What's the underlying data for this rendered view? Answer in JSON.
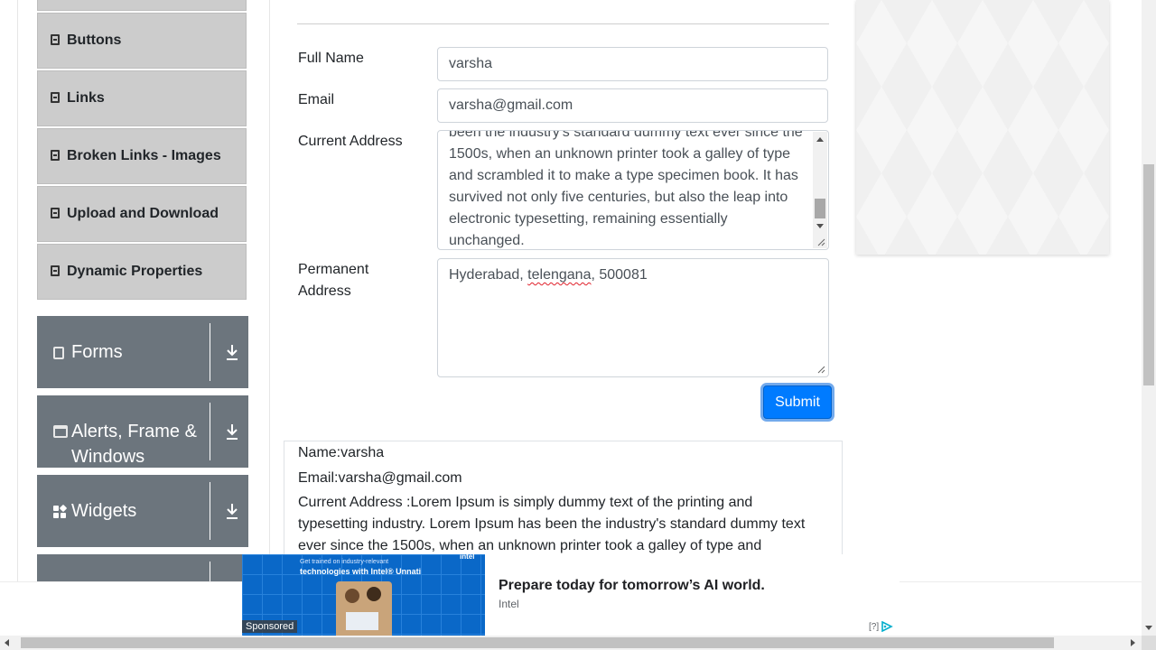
{
  "sidebar": {
    "element_items": [
      {
        "label": "Buttons"
      },
      {
        "label": "Links"
      },
      {
        "label": "Broken Links - Images"
      },
      {
        "label": "Upload and Download"
      },
      {
        "label": "Dynamic Properties"
      }
    ],
    "groups": [
      {
        "label": "Forms",
        "icon": "form-icon"
      },
      {
        "label": "Alerts, Frame & Windows",
        "icon": "window-icon"
      },
      {
        "label": "Widgets",
        "icon": "widgets-icon"
      }
    ]
  },
  "form": {
    "full_name": {
      "label": "Full Name",
      "value": "varsha"
    },
    "email": {
      "label": "Email",
      "value": "varsha@gmail.com"
    },
    "current_address": {
      "label": "Current Address",
      "visible_lines": [
        "been the industry's standard dummy text ever since the",
        "1500s, when an unknown printer took a galley of type",
        "and scrambled it to make a type specimen book. It has",
        "survived not only five centuries, but also the leap into",
        "electronic typesetting, remaining essentially",
        "unchanged."
      ]
    },
    "permanent_address": {
      "label_line1": "Permanent",
      "label_line2": "Address",
      "value_part1": "Hyderabad, ",
      "value_misspelled": "telengana",
      "value_part2": ", 500081"
    },
    "submit_label": "Submit"
  },
  "output": {
    "name": "Name:varsha",
    "email": "Email:varsha@gmail.com",
    "current_address": "Current Address :Lorem Ipsum is simply dummy text of the printing and typesetting industry. Lorem Ipsum has been the industry's standard dummy text ever since the 1500s, when an unknown printer took a galley of type and"
  },
  "ad": {
    "image_small_text": "Get trained on industry-relevant",
    "image_headline": "technologies with Intel® Unnati",
    "image_brand": "intel",
    "sponsored_label": "Sponsored",
    "headline": "Prepare today for tomorrow’s AI world.",
    "brand": "Intel",
    "choices_label": "[?]",
    "choices_icon": "adchoices-icon"
  },
  "colors": {
    "primary": "#007bff",
    "sidebar_group": "#6c757d",
    "sidebar_item": "#cccccc"
  }
}
